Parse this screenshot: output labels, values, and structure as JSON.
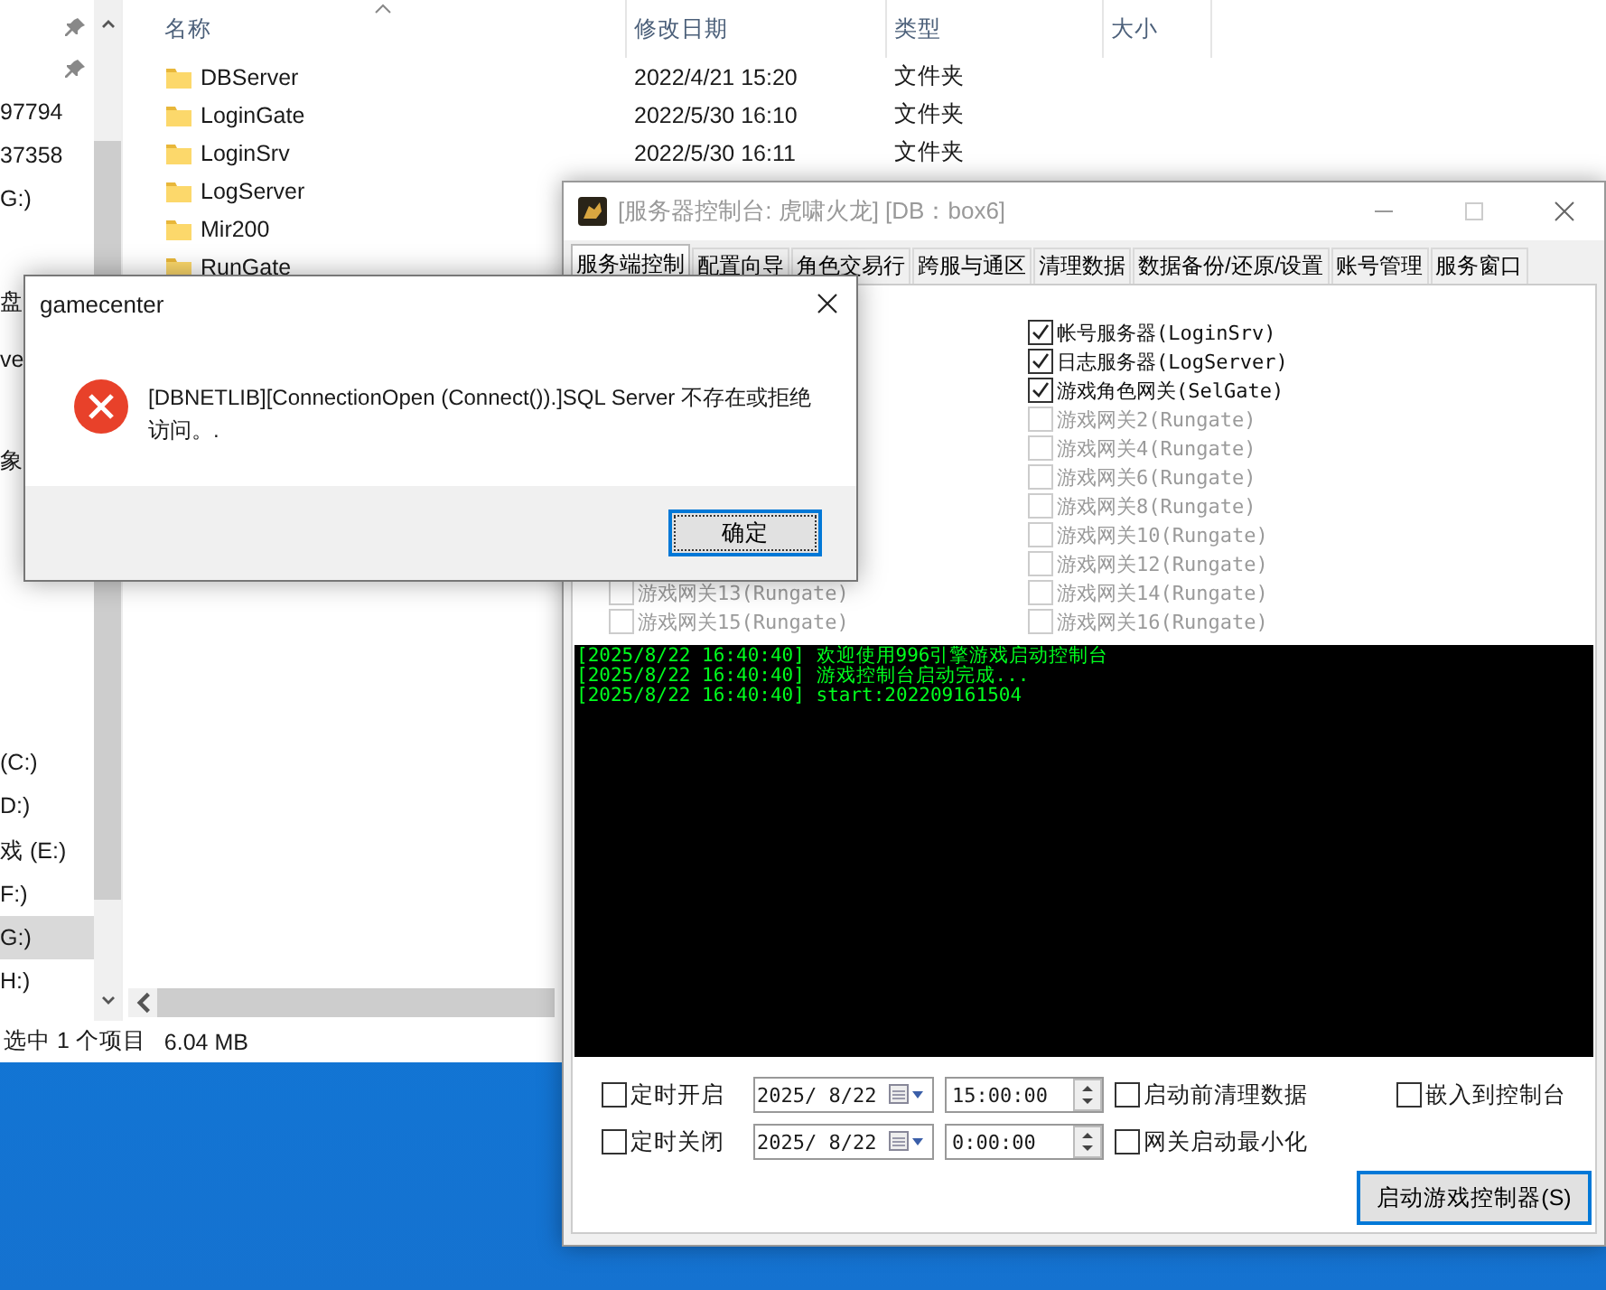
{
  "explorer": {
    "nav_items": [
      {
        "pinned": true,
        "selected": false
      },
      {
        "pinned": true,
        "selected": false
      },
      {
        "label": "97794",
        "pinned": false,
        "selected": false
      },
      {
        "label": "37358",
        "pinned": false,
        "selected": false
      },
      {
        "label": "G:)",
        "pinned": false,
        "selected": false
      },
      {
        "label": "盘",
        "pinned": false,
        "selected": false
      },
      {
        "label": "ve",
        "pinned": false,
        "selected": false
      },
      {
        "label": "象",
        "pinned": false,
        "selected": false
      },
      {
        "label": "(C:)",
        "pinned": false,
        "selected": false
      },
      {
        "label": "D:)",
        "pinned": false,
        "selected": false
      },
      {
        "label": "戏 (E:)",
        "pinned": false,
        "selected": false
      },
      {
        "label": "F:)",
        "pinned": false,
        "selected": false
      },
      {
        "label": "G:)",
        "pinned": false,
        "selected": true
      },
      {
        "label": "H:)",
        "pinned": false,
        "selected": false
      }
    ],
    "columns": [
      "名称",
      "修改日期",
      "类型",
      "大小"
    ],
    "rows": [
      {
        "name": "DBServer",
        "modified": "2022/4/21 15:20",
        "type": "文件夹"
      },
      {
        "name": "LoginGate",
        "modified": "2022/5/30 16:10",
        "type": "文件夹"
      },
      {
        "name": "LoginSrv",
        "modified": "2022/5/30 16:11",
        "type": "文件夹"
      },
      {
        "name": "LogServer"
      },
      {
        "name": "Mir200"
      },
      {
        "name": "RunGate"
      }
    ],
    "status_bar": {
      "selection": "选中 1 个项目",
      "size": "6.04 MB"
    }
  },
  "control_window": {
    "title": "[服务器控制台: 虎啸火龙] [DB：box6]",
    "tabs": [
      {
        "label": "服务端控制",
        "selected": true
      },
      {
        "label": "配置向导",
        "selected": false
      },
      {
        "label": "角色交易行",
        "selected": false
      },
      {
        "label": "跨服与通区",
        "selected": false
      },
      {
        "label": "清理数据",
        "selected": false
      },
      {
        "label": "数据备份/还原/设置",
        "selected": false
      },
      {
        "label": "账号管理",
        "selected": false
      },
      {
        "label": "服务窗口",
        "selected": false
      }
    ],
    "server_checkboxes": {
      "left": [
        {
          "label": "游戏网关13(Rungate)",
          "checked": false,
          "disabled": true
        },
        {
          "label": "游戏网关15(Rungate)",
          "checked": false,
          "disabled": true
        }
      ],
      "right": [
        {
          "label": "帐号服务器(LoginSrv)",
          "checked": true,
          "disabled": false
        },
        {
          "label": "日志服务器(LogServer)",
          "checked": true,
          "disabled": false
        },
        {
          "label": "游戏角色网关(SelGate)",
          "checked": true,
          "disabled": false
        },
        {
          "label": "游戏网关2(Rungate)",
          "checked": false,
          "disabled": true
        },
        {
          "label": "游戏网关4(Rungate)",
          "checked": false,
          "disabled": true
        },
        {
          "label": "游戏网关6(Rungate)",
          "checked": false,
          "disabled": true
        },
        {
          "label": "游戏网关8(Rungate)",
          "checked": false,
          "disabled": true
        },
        {
          "label": "游戏网关10(Rungate)",
          "checked": false,
          "disabled": true
        },
        {
          "label": "游戏网关12(Rungate)",
          "checked": false,
          "disabled": true
        },
        {
          "label": "游戏网关14(Rungate)",
          "checked": false,
          "disabled": true
        },
        {
          "label": "游戏网关16(Rungate)",
          "checked": false,
          "disabled": true
        }
      ]
    },
    "console_lines": [
      "[2025/8/22 16:40:40] 欢迎使用996引擎游戏启动控制台",
      "[2025/8/22 16:40:40] 游戏控制台启动完成...",
      "[2025/8/22 16:40:40] start:202209161504"
    ],
    "schedule": [
      {
        "label": "定时开启",
        "checked": false,
        "date": "2025/ 8/22",
        "time": "15:00:00"
      },
      {
        "label": "定时关闭",
        "checked": false,
        "date": "2025/ 8/22",
        "time": "0:00:00"
      }
    ],
    "options": [
      {
        "label": "启动前清理数据",
        "checked": false
      },
      {
        "label": "嵌入到控制台",
        "checked": false
      },
      {
        "label": "网关启动最小化",
        "checked": false
      }
    ],
    "start_button": "启动游戏控制器(S)"
  },
  "dialog": {
    "title": "gamecenter",
    "message": "[DBNETLIB][ConnectionOpen (Connect()).]SQL Server 不存在或拒绝访问。.",
    "button": "确定"
  }
}
